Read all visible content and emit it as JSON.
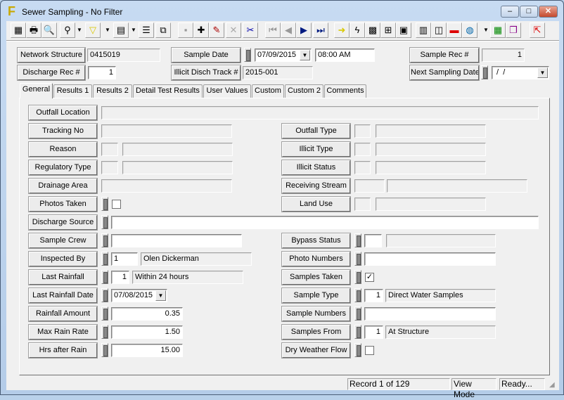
{
  "window": {
    "title": "Sewer Sampling - No Filter",
    "minimize": "–",
    "maximize": "□",
    "close": "✕"
  },
  "toolbar": {
    "icons": [
      "grid-icon",
      "print-icon",
      "preview-icon",
      "binoculars-icon",
      "filter-icon",
      "report-icon",
      "properties-icon",
      "export-icon",
      "save-icon",
      "add-record-icon",
      "edit-icon",
      "delete-icon",
      "cut-icon",
      "first-record-icon",
      "previous-record-icon",
      "next-record-icon",
      "last-record-icon",
      "goto-icon",
      "lightning-icon",
      "map-icon",
      "network-icon",
      "camera-icon",
      "calculator-icon",
      "structure-icon",
      "toolbox-icon",
      "globe-icon",
      "spreadsheet-icon",
      "help-book-icon",
      "exit-icon"
    ]
  },
  "header": {
    "network_structure": {
      "label": "Network Structure",
      "value": "0415019"
    },
    "sample_date": {
      "label": "Sample Date",
      "date": "07/09/2015",
      "time": "08:00 AM"
    },
    "sample_rec": {
      "label": "Sample Rec #",
      "value": "1"
    },
    "discharge_rec": {
      "label": "Discharge Rec #",
      "value": "1"
    },
    "illicit_track": {
      "label": "Illicit Disch Track #",
      "value": "2015-001"
    },
    "next_sampling": {
      "label": "Next Sampling Date",
      "value": " /  /"
    }
  },
  "tabs": [
    {
      "label": "General",
      "selected": true
    },
    {
      "label": "Results 1"
    },
    {
      "label": "Results 2"
    },
    {
      "label": "Detail Test Results"
    },
    {
      "label": "User Values"
    },
    {
      "label": "Custom"
    },
    {
      "label": "Custom 2"
    },
    {
      "label": "Comments"
    }
  ],
  "general": {
    "outfall_location": {
      "label": "Outfall Location",
      "value": ""
    },
    "tracking_no": {
      "label": "Tracking No",
      "value": ""
    },
    "reason": {
      "label": "Reason",
      "code": "",
      "desc": ""
    },
    "regulatory_type": {
      "label": "Regulatory Type",
      "code": "",
      "desc": ""
    },
    "drainage_area": {
      "label": "Drainage Area",
      "value": ""
    },
    "photos_taken": {
      "label": "Photos Taken",
      "checked": false
    },
    "discharge_source": {
      "label": "Discharge Source",
      "value": ""
    },
    "sample_crew": {
      "label": "Sample Crew",
      "value": ""
    },
    "inspected_by": {
      "label": "Inspected By",
      "code": "1",
      "desc": "Olen Dickerman"
    },
    "last_rainfall": {
      "label": "Last Rainfall",
      "code": "1",
      "desc": "Within 24 hours"
    },
    "last_rainfall_date": {
      "label": "Last Rainfall Date",
      "value": "07/08/2015"
    },
    "rainfall_amount": {
      "label": "Rainfall Amount",
      "value": "0.35"
    },
    "max_rain_rate": {
      "label": "Max Rain Rate",
      "value": "1.50"
    },
    "hrs_after_rain": {
      "label": "Hrs after Rain",
      "value": "15.00"
    },
    "outfall_type": {
      "label": "Outfall Type",
      "code": "",
      "desc": ""
    },
    "illicit_type": {
      "label": "Illicit Type",
      "code": "",
      "desc": ""
    },
    "illicit_status": {
      "label": "Illicit Status",
      "code": "",
      "desc": ""
    },
    "receiving_stream": {
      "label": "Receiving Stream",
      "code": "",
      "desc": ""
    },
    "land_use": {
      "label": "Land Use",
      "code": "",
      "desc": ""
    },
    "bypass_status": {
      "label": "Bypass Status",
      "code": "",
      "desc": ""
    },
    "photo_numbers": {
      "label": "Photo Numbers",
      "value": ""
    },
    "samples_taken": {
      "label": "Samples Taken",
      "checked": true
    },
    "sample_type": {
      "label": "Sample Type",
      "code": "1",
      "desc": "Direct Water Samples"
    },
    "sample_numbers": {
      "label": "Sample Numbers",
      "value": ""
    },
    "samples_from": {
      "label": "Samples From",
      "code": "1",
      "desc": "At Structure"
    },
    "dry_weather_flow": {
      "label": "Dry Weather Flow",
      "checked": false
    }
  },
  "status": {
    "record": "Record 1 of 129",
    "mode": "View Mode",
    "state": "Ready..."
  }
}
